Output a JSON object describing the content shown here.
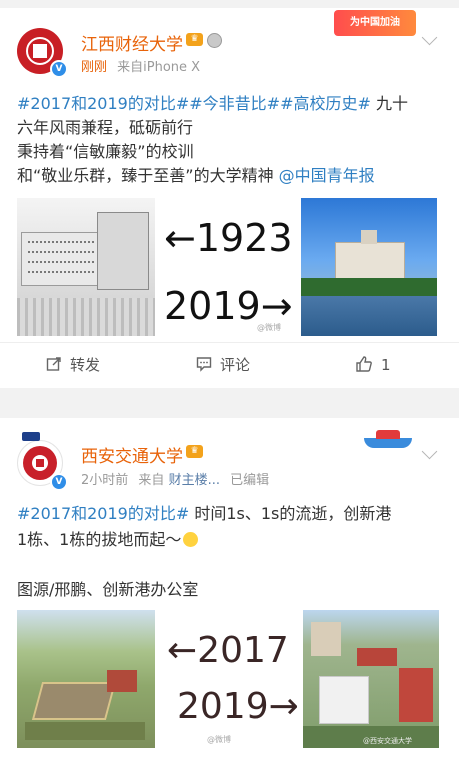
{
  "post1": {
    "username": "江西财经大学",
    "meta_time": "刚刚",
    "meta_source": "来自iPhone X",
    "banner_text": "为中国加油",
    "line1_tags": "#2017和2019的对比##今非昔比##高校历史#",
    "line1_rest": " 九十",
    "line2": "六年风雨兼程，砥砺前行",
    "line3": "秉持着“信敏廉毅”的校训",
    "line4_text": "和“敬业乐群，臻于至善”的大学精神 ",
    "line4_mention": "@中国青年报",
    "img_text_top": "←1923",
    "img_text_bottom": "2019→",
    "watermark": "@微博",
    "actions": {
      "repost": "转发",
      "comment": "评论",
      "like_count": "1"
    }
  },
  "post2": {
    "username": "西安交通大学",
    "meta_time": "2小时前",
    "meta_from": "来自",
    "meta_source": "财主楼...",
    "meta_edited": "已编辑",
    "line1_tag": "#2017和2019的对比#",
    "line1_rest": " 时间1s、1s的流逝，创新港",
    "line2": "1栋、1栋的拔地而起～",
    "line3": "图源/邢鹏、创新港办公室",
    "img_text_top": "←2017",
    "img_text_bottom": "2019→",
    "watermark_left": "@微博",
    "watermark_right": "@西安交通大学"
  },
  "colors": {
    "brand_orange": "#e8630a",
    "link_blue": "#2f7fc2",
    "verified_blue": "#2f8ee8"
  }
}
